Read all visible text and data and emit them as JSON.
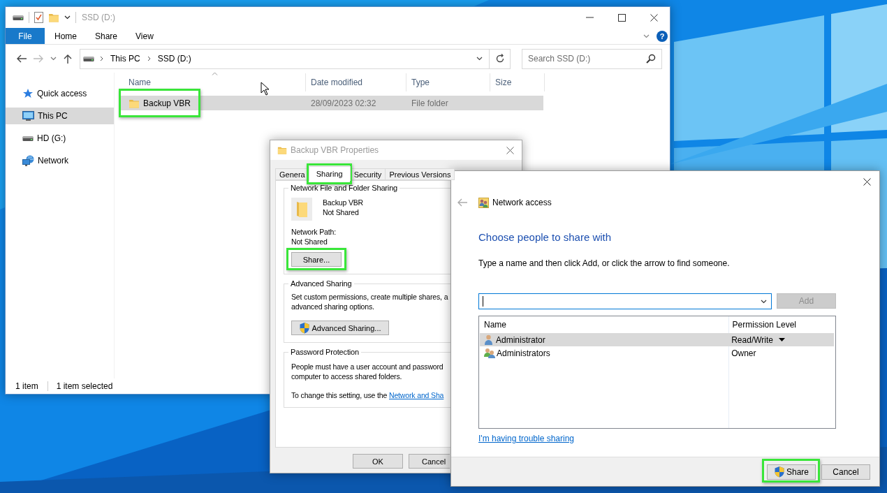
{
  "explorer": {
    "title": "SSD (D:)",
    "ribbon_tabs": [
      {
        "label": "File",
        "kind": "file"
      },
      {
        "label": "Home",
        "kind": "tab"
      },
      {
        "label": "Share",
        "kind": "tab"
      },
      {
        "label": "View",
        "kind": "tab"
      }
    ],
    "help": "?",
    "breadcrumb": [
      "This PC",
      "SSD (D:)"
    ],
    "search": {
      "placeholder": "Search SSD (D:)"
    },
    "sidebar": {
      "items": [
        {
          "label": "Quick access",
          "selected": false
        },
        {
          "label": "This PC",
          "selected": true
        },
        {
          "label": "HD (G:)",
          "selected": false
        },
        {
          "label": "Network",
          "selected": false
        }
      ]
    },
    "columns": [
      "Name",
      "Date modified",
      "Type",
      "Size"
    ],
    "rows": [
      {
        "name": "Backup VBR",
        "date_modified": "28/09/2023 02:32",
        "type": "File folder",
        "selected": true,
        "highlighted": true
      }
    ],
    "status_bar": [
      "1 item",
      "1 item selected"
    ]
  },
  "properties": {
    "title": "Backup VBR Properties",
    "tabs": [
      {
        "label": "Genera",
        "selected": false,
        "highlighted": false
      },
      {
        "label": "Sharing",
        "selected": true,
        "highlighted": true
      },
      {
        "label": "Security",
        "selected": false,
        "highlighted": false
      },
      {
        "label": "Previous Versions",
        "selected": false,
        "highlighted": false
      }
    ],
    "network_sharing": {
      "title": "Network File and Folder Sharing",
      "folder_name": "Backup VBR",
      "folder_status": "Not Shared",
      "path_label": "Network Path:",
      "path_value": "Not Shared",
      "button": {
        "label": "Share...",
        "highlighted": true
      }
    },
    "advanced_sharing": {
      "title": "Advanced Sharing",
      "lines": [
        "Set custom permissions, create multiple shares, a",
        "advanced sharing options."
      ],
      "button": "Advanced Sharing..."
    },
    "password_protection": {
      "title": "Password Protection",
      "lines": [
        "People must have a user account and password",
        "computer to access shared folders."
      ],
      "note": "To change this setting, use the",
      "link": "Network and Sha"
    },
    "buttons": [
      "OK",
      "Cancel"
    ]
  },
  "network_access": {
    "title": "Network access",
    "heading": "Choose people to share with",
    "instruction": "Type a name and then click Add, or click the arrow to find someone.",
    "add_button": {
      "label": "Add",
      "disabled": true
    },
    "columns": [
      "Name",
      "Permission Level"
    ],
    "rows": [
      {
        "name": "Administrator",
        "permission": "Read/Write",
        "kind": "user",
        "selected": true
      },
      {
        "name": "Administrators",
        "permission": "Owner",
        "kind": "group",
        "selected": false
      }
    ],
    "link": "I'm having trouble sharing",
    "buttons": [
      {
        "label": "Share",
        "kind": "elevated",
        "highlighted": true
      },
      {
        "label": "Cancel",
        "kind": "plain",
        "highlighted": false
      }
    ]
  }
}
